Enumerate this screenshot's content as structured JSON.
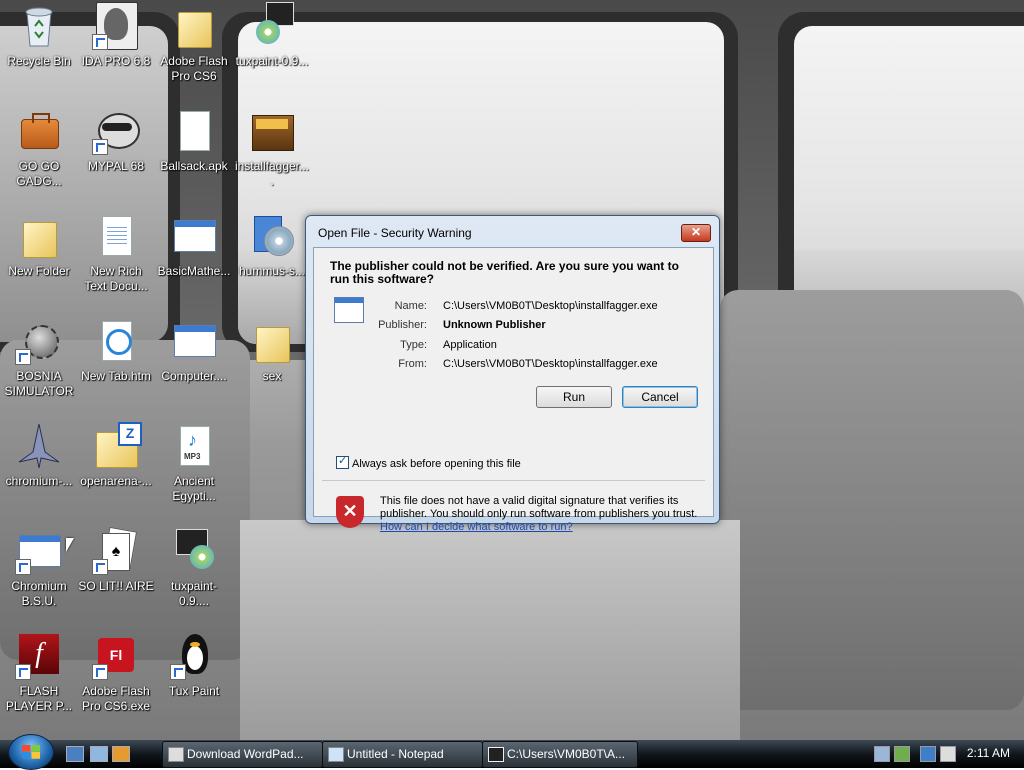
{
  "desktop_icons": [
    {
      "label": "Recycle Bin",
      "icon": "recycle-bin-icon"
    },
    {
      "label": "IDA PRO 6.8",
      "icon": "ida-pro-icon"
    },
    {
      "label": "Adobe Flash Pro CS6",
      "icon": "folder-icon"
    },
    {
      "label": "tuxpaint-0.9...",
      "icon": "tuxpaint-installer-icon"
    },
    {
      "label": "GO GO GADG...",
      "icon": "briefcase-icon"
    },
    {
      "label": "MYPAL 68",
      "icon": "raccoon-icon"
    },
    {
      "label": "Ballsack.apk",
      "icon": "file-icon"
    },
    {
      "label": "installfagger....",
      "icon": "installer-icon"
    },
    {
      "label": "New Folder",
      "icon": "folder-icon"
    },
    {
      "label": "New Rich Text Docu...",
      "icon": "rich-text-document-icon"
    },
    {
      "label": "BasicMathe...",
      "icon": "application-icon"
    },
    {
      "label": "hummus-s...",
      "icon": "cd-installer-icon"
    },
    {
      "label": "BOSNIA SIMULATOR",
      "icon": "spiked-ball-icon"
    },
    {
      "label": "New Tab.htm",
      "icon": "html-document-icon"
    },
    {
      "label": "Computer....",
      "icon": "application-icon"
    },
    {
      "label": "sex",
      "icon": "folder-icon"
    },
    {
      "label": "chromium-...",
      "icon": "jet-icon"
    },
    {
      "label": "openarena-...",
      "icon": "zip-folder-icon"
    },
    {
      "label": "Ancient Egypti...",
      "icon": "mp3-file-icon"
    },
    {
      "label": "Chromium B.S.U.",
      "icon": "application-icon"
    },
    {
      "label": "SO LIT!! AIRE",
      "icon": "cards-icon"
    },
    {
      "label": "tuxpaint-0.9....",
      "icon": "tuxpaint-installer-icon"
    },
    {
      "label": "FLASH PLAYER P...",
      "icon": "flash-player-icon"
    },
    {
      "label": "Adobe Flash Pro CS6.exe",
      "icon": "flash-pro-icon"
    },
    {
      "label": "Tux Paint",
      "icon": "tux-penguin-icon"
    }
  ],
  "dialog": {
    "title": "Open File - Security Warning",
    "close_label": "✕",
    "question": "The publisher could not be verified.  Are you sure you want to run this software?",
    "fields": [
      {
        "key": "Name:",
        "value": "C:\\Users\\VM0B0T\\Desktop\\installfagger.exe",
        "bold": false
      },
      {
        "key": "Publisher:",
        "value": "Unknown Publisher",
        "bold": true
      },
      {
        "key": "Type:",
        "value": "Application",
        "bold": false
      },
      {
        "key": "From:",
        "value": "C:\\Users\\VM0B0T\\Desktop\\installfagger.exe",
        "bold": false
      }
    ],
    "run_label": "Run",
    "cancel_label": "Cancel",
    "checkbox_label": "Always ask before opening this file",
    "checkbox_checked": true,
    "warning_text": "This file does not have a valid digital signature that verifies its publisher.  You should only run software from publishers you trust.",
    "warning_link": "How can I decide what software to run?"
  },
  "taskbar": {
    "tasks": [
      {
        "label": "Download WordPad...",
        "icon": "wordpad-icon"
      },
      {
        "label": "Untitled - Notepad",
        "icon": "notepad-icon"
      },
      {
        "label": "C:\\Users\\VM0B0T\\A...",
        "icon": "7zip-icon"
      }
    ],
    "clock": "2:11 AM"
  },
  "colors": {
    "dialog_accent": "#3c7bd0",
    "shield": "#c8282b",
    "link": "#1a4bb8"
  }
}
